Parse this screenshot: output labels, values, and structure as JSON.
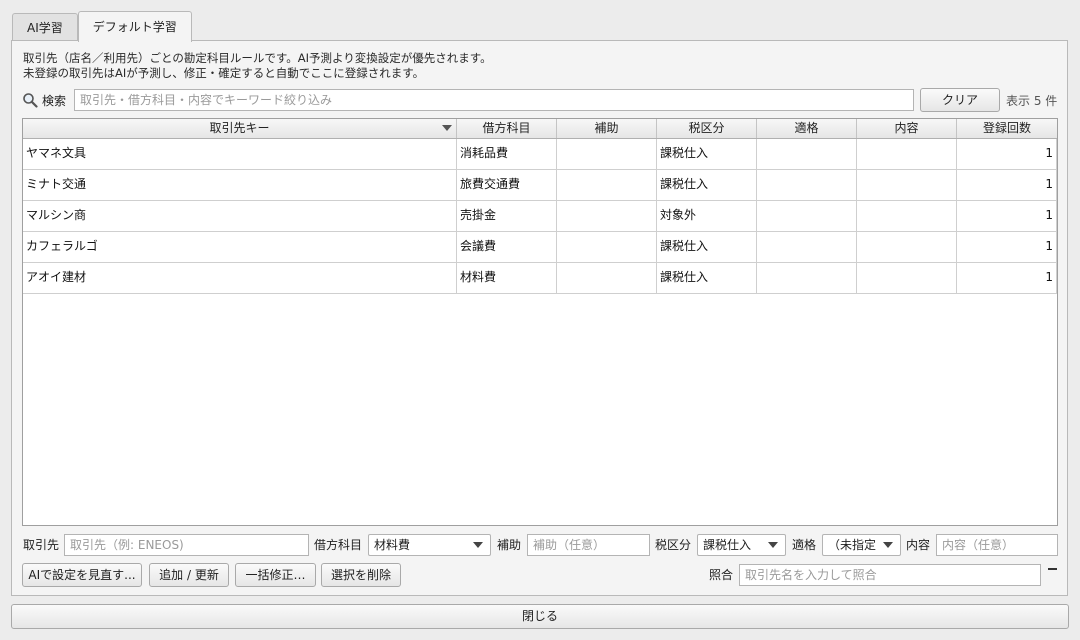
{
  "tabs": [
    "AI学習",
    "デフォルト学習"
  ],
  "description": {
    "line1": "取引先（店名／利用先）ごとの勘定科目ルールです。AI予測より変換設定が優先されます。",
    "line2": "未登録の取引先はAIが予測し、修正・確定すると自動でここに登録されます。"
  },
  "search": {
    "label": "検索",
    "placeholder": "取引先・借方科目・内容でキーワード絞り込み",
    "clear_label": "クリア",
    "count_text": "表示 5 件"
  },
  "table": {
    "columns": [
      "取引先キー",
      "借方科目",
      "補助",
      "税区分",
      "適格",
      "内容",
      "登録回数"
    ],
    "rows": [
      {
        "key": "ヤマネ文具",
        "debit": "消耗品費",
        "sub": "",
        "tax": "課税仕入",
        "qualified": "",
        "content": "",
        "count": "1"
      },
      {
        "key": "ミナト交通",
        "debit": "旅費交通費",
        "sub": "",
        "tax": "課税仕入",
        "qualified": "",
        "content": "",
        "count": "1"
      },
      {
        "key": "マルシン商",
        "debit": "売掛金",
        "sub": "",
        "tax": "対象外",
        "qualified": "",
        "content": "",
        "count": "1"
      },
      {
        "key": "カフェラルゴ",
        "debit": "会議費",
        "sub": "",
        "tax": "課税仕入",
        "qualified": "",
        "content": "",
        "count": "1"
      },
      {
        "key": "アオイ建材",
        "debit": "材料費",
        "sub": "",
        "tax": "課税仕入",
        "qualified": "",
        "content": "",
        "count": "1"
      }
    ]
  },
  "form": {
    "vendor_label": "取引先",
    "vendor_placeholder": "取引先（例: ENEOS)",
    "debit_label": "借方科目",
    "debit_value": "材料費",
    "sub_label": "補助",
    "sub_placeholder": "補助（任意）",
    "tax_label": "税区分",
    "tax_value": "課税仕入",
    "qualified_label": "適格",
    "qualified_value": "（未指定",
    "content_label": "内容",
    "content_placeholder": "内容（任意）"
  },
  "actions": {
    "ai_review": "AIで設定を見直す...",
    "add_update": "追加 / 更新",
    "bulk_edit": "一括修正…",
    "delete_selected": "選択を削除",
    "match_label": "照合",
    "match_placeholder": "取引先名を入力して照合"
  },
  "close_label": "閉じる"
}
